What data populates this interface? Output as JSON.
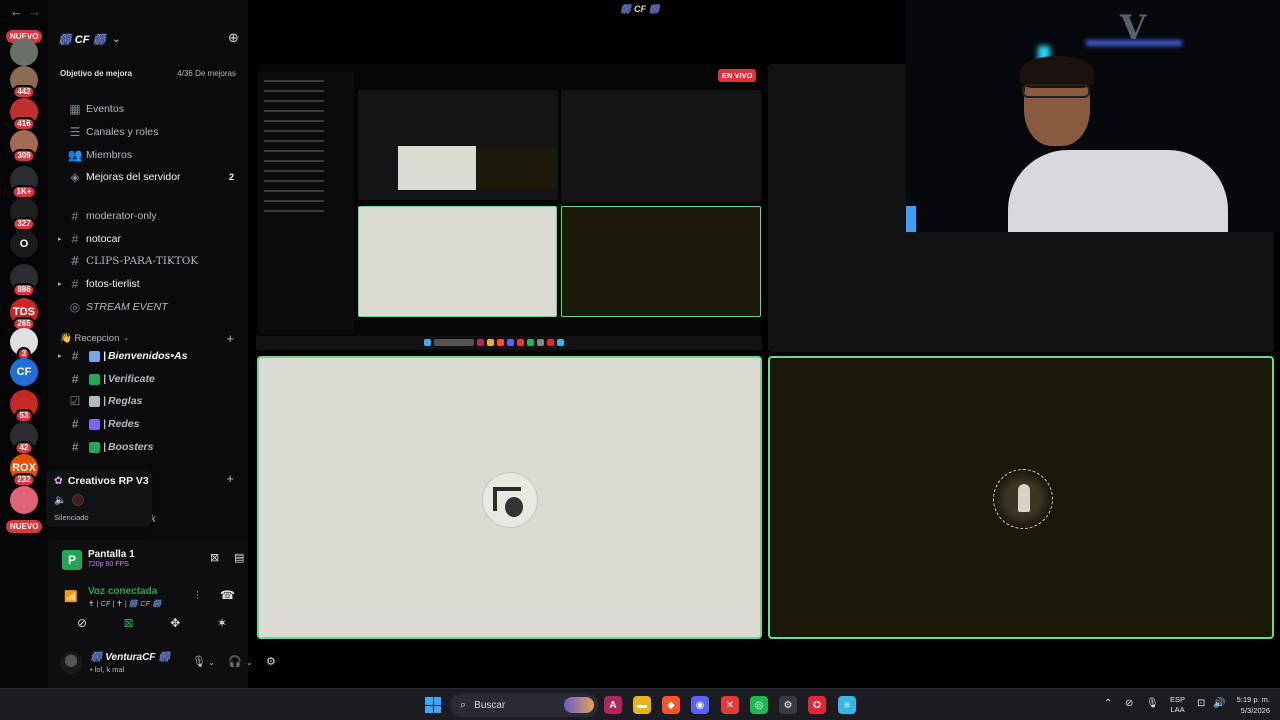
{
  "window": {
    "title": "🎆 CF 🎆",
    "back": "←",
    "forward": "→"
  },
  "rail": {
    "new_top": "NUEVO",
    "new_bottom": "NUEVO",
    "servers": [
      {
        "name": "server-1",
        "initial": "",
        "color": "#6b6f6a",
        "badge": ""
      },
      {
        "name": "server-2",
        "initial": "",
        "color": "#8a6a55",
        "badge": "442"
      },
      {
        "name": "server-3",
        "initial": "",
        "color": "#c32f2f",
        "badge": "416"
      },
      {
        "name": "server-4",
        "initial": "",
        "color": "#a56a57",
        "badge": "309"
      },
      {
        "name": "server-5",
        "initial": "",
        "color": "#2b2d31",
        "badge": "1K+"
      },
      {
        "name": "server-6",
        "initial": "",
        "color": "#1f1f1f",
        "badge": "327"
      },
      {
        "name": "server-7",
        "initial": "O",
        "color": "#1a1a1a",
        "badge": ""
      },
      {
        "name": "server-8",
        "initial": "",
        "color": "#2b2d31",
        "badge": "886"
      },
      {
        "name": "server-9",
        "initial": "TDS",
        "color": "#c62828",
        "badge": "265"
      },
      {
        "name": "server-10",
        "initial": "",
        "color": "#e0e0e0",
        "badge": "3"
      },
      {
        "name": "server-11",
        "initial": "CF",
        "color": "#1e6fd9",
        "badge": ""
      },
      {
        "name": "server-12",
        "initial": "",
        "color": "#c62828",
        "badge": "53"
      },
      {
        "name": "server-13",
        "initial": "",
        "color": "#2b2d31",
        "badge": "42"
      },
      {
        "name": "server-14",
        "initial": "ROX",
        "color": "#e65100",
        "badge": "232"
      },
      {
        "name": "server-15",
        "initial": "",
        "color": "#e0637a",
        "badge": ""
      }
    ]
  },
  "sidebar": {
    "guild_name": "🎆 CF 🎆",
    "boost_goal": "Objetivo de mejora",
    "boost_progress": "4/36 De mejoras",
    "nav": [
      {
        "label": "Eventos",
        "icon": "▦"
      },
      {
        "label": "Canales y roles",
        "icon": "☰"
      },
      {
        "label": "Miembros",
        "icon": "👥"
      },
      {
        "label": "Mejoras del servidor",
        "icon": "◈",
        "count": "2"
      }
    ],
    "channels_a": [
      {
        "label": "moderator-only",
        "icon": "#",
        "arrow": ""
      },
      {
        "label": "notocar",
        "icon": "#",
        "arrow": "▸"
      },
      {
        "label": "CLIPS-PARA-TIKTOK",
        "icon": "#",
        "arrow": ""
      },
      {
        "label": "fotos-tierlist",
        "icon": "#",
        "arrow": "▸"
      },
      {
        "label": "STREAM EVENT",
        "icon": "◎",
        "arrow": ""
      }
    ],
    "category": "👋 Recepcion",
    "channels_b": [
      {
        "label": "Bienvenidos•As",
        "icon": "#",
        "arrow": "▸",
        "emoji_color": "#7aa7e0"
      },
      {
        "label": "Verificate",
        "icon": "#",
        "arrow": "",
        "emoji_color": "#23a55a"
      },
      {
        "label": "Reglas",
        "icon": "☑",
        "arrow": "",
        "emoji_color": "#b5bac1"
      },
      {
        "label": "Redes",
        "icon": "#",
        "arrow": "",
        "emoji_color": "#7b68ee"
      },
      {
        "label": "Boosters",
        "icon": "#",
        "arrow": "",
        "emoji_color": "#23a55a"
      }
    ],
    "partial": "ck"
  },
  "tooltip": {
    "server": "Creativos RP V3",
    "status": "Silenciado"
  },
  "stream_panel": {
    "source_name": "Pantalla 1",
    "resolution": "720p 60 FPS",
    "voice_status": "Voz conectada",
    "voice_channel": "✝ | CF | ✝ | 🎆 CF 🎆",
    "username": "🎆 VenturaCF 🎆",
    "user_status": "• lol, k mal"
  },
  "stage": {
    "live_label": "EN VIVO",
    "mini_tiles": [
      {
        "color": "#dcdbd3"
      },
      {
        "color": "#1a1809"
      },
      {
        "color": "#111214"
      }
    ]
  },
  "taskbar": {
    "search_placeholder": "Buscar",
    "apps": [
      {
        "name": "app-affinity",
        "glyph": "A",
        "color": "#b0265a"
      },
      {
        "name": "app-explorer",
        "glyph": "▬",
        "color": "#e6b325"
      },
      {
        "name": "app-brave",
        "glyph": "◆",
        "color": "#fb542b"
      },
      {
        "name": "app-discord",
        "glyph": "◉",
        "color": "#5865f2"
      },
      {
        "name": "app-capcut",
        "glyph": "✕",
        "color": "#e33b3b"
      },
      {
        "name": "app-spotify",
        "glyph": "◎",
        "color": "#1db954"
      },
      {
        "name": "app-steam",
        "glyph": "⚙",
        "color": "#3a3a3a"
      },
      {
        "name": "app-opera",
        "glyph": "O",
        "color": "#e0283b"
      },
      {
        "name": "app-notepad",
        "glyph": "≡",
        "color": "#38b5e8"
      }
    ],
    "lang_top": "ESP",
    "lang_bottom": "LAA",
    "time": "5:19 p. m.",
    "date": "5/3/2026"
  }
}
